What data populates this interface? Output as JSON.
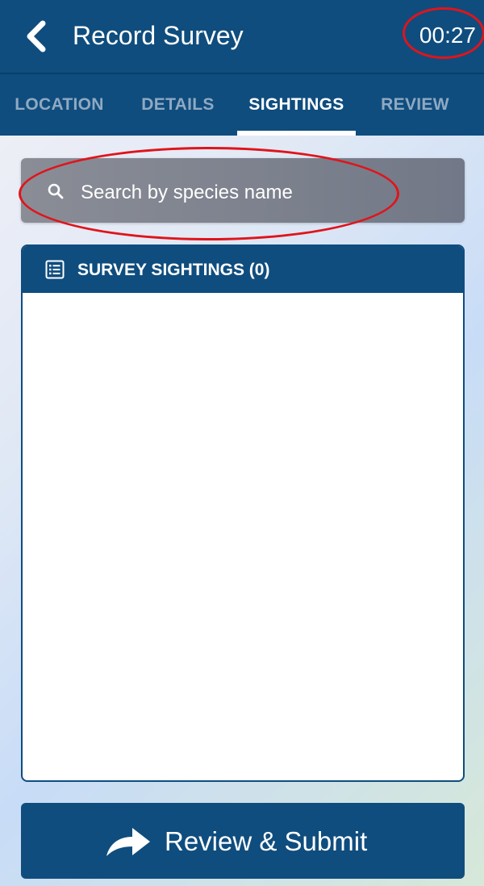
{
  "header": {
    "title": "Record Survey",
    "timer": "00:27",
    "back_icon": "chevron-left-icon"
  },
  "tabs": [
    {
      "label": "LOCATION",
      "active": false
    },
    {
      "label": "DETAILS",
      "active": false
    },
    {
      "label": "SIGHTINGS",
      "active": true
    },
    {
      "label": "REVIEW",
      "active": false
    }
  ],
  "search": {
    "placeholder": "Search by species name",
    "value": "",
    "icon": "search-icon"
  },
  "sightings_panel": {
    "title": "SURVEY SIGHTINGS (0)",
    "icon": "list-icon",
    "items": []
  },
  "submit": {
    "label": "Review & Submit",
    "icon": "share-arrow-icon"
  },
  "annotations": {
    "highlight_color": "#e0141b"
  },
  "colors": {
    "primary": "#0f4d7e",
    "inactive_tab": "#8fa9c2",
    "search_bg": "#7e828d"
  }
}
